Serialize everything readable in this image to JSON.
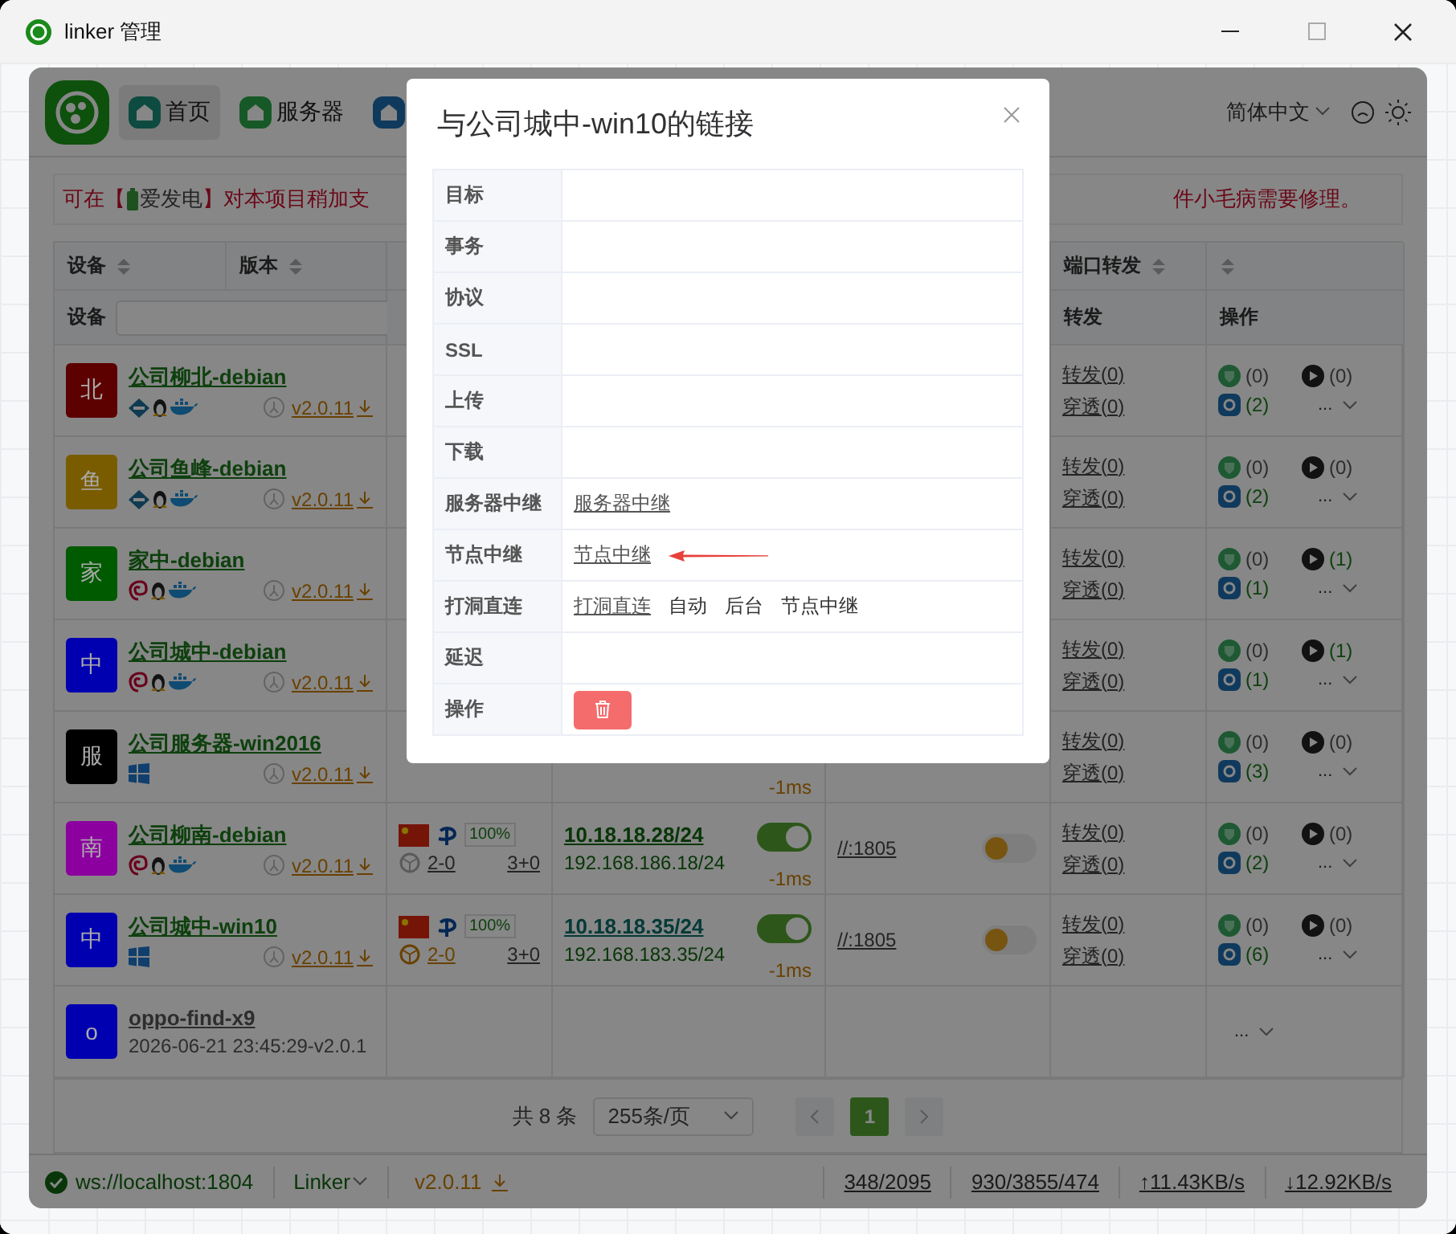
{
  "window": {
    "title": "linker 管理"
  },
  "nav": {
    "tabs": [
      {
        "label": "首页",
        "selected": true
      },
      {
        "label": "服务器",
        "selected": false
      },
      {
        "selected": false
      }
    ],
    "language": "简体中文"
  },
  "banner": {
    "before": "可在【",
    "sponsor": "爱发电",
    "after": "】对本项目稍加支",
    "tail": "件小毛病需要修理。"
  },
  "table": {
    "header_top": [
      {
        "label": "设备",
        "sort": true
      },
      {
        "label": "版本",
        "sort": true
      },
      {
        "sort": false
      },
      {
        "label": "端口转发",
        "sort": true
      },
      {
        "sort": true
      }
    ],
    "header_bottom": {
      "device": "设备",
      "forward": "转发",
      "ops": "操作"
    },
    "rows": [
      {
        "avatar": "北",
        "color": "#5c0000",
        "name": "公司柳北-debian",
        "online": true,
        "os": [
          {
            "kind": "router"
          },
          {
            "kind": "linux"
          },
          {
            "kind": "docker"
          }
        ],
        "version": "v2.0.11",
        "forward": {
          "a": "转发(0)",
          "b": "穿透(0)"
        },
        "ops": {
          "shield": "(0)",
          "shield_active": false,
          "play": "(0)",
          "play_active": false,
          "tunnel": "(2)",
          "tunnel_active": true,
          "more": "..."
        }
      },
      {
        "avatar": "鱼",
        "color": "#7a5c00",
        "name": "公司鱼峰-debian",
        "online": true,
        "os": [
          {
            "kind": "router"
          },
          {
            "kind": "linux"
          },
          {
            "kind": "docker"
          }
        ],
        "version": "v2.0.11",
        "forward": {
          "a": "转发(0)",
          "b": "穿透(0)"
        },
        "ops": {
          "shield": "(0)",
          "shield_active": false,
          "play": "(0)",
          "play_active": false,
          "tunnel": "(2)",
          "tunnel_active": true,
          "more": "..."
        }
      },
      {
        "avatar": "家",
        "color": "#005a00",
        "name": "家中-debian",
        "online": true,
        "os": [
          {
            "kind": "debian"
          },
          {
            "kind": "linux"
          },
          {
            "kind": "docker"
          }
        ],
        "version": "v2.0.11",
        "forward": {
          "a": "转发(0)",
          "b": "穿透(0)"
        },
        "ops": {
          "shield": "(0)",
          "shield_active": false,
          "play": "(1)",
          "play_active": true,
          "tunnel": "(1)",
          "tunnel_active": true,
          "more": "..."
        }
      },
      {
        "avatar": "中",
        "color": "#0000b0",
        "name": "公司城中-debian",
        "online": true,
        "os": [
          {
            "kind": "debian"
          },
          {
            "kind": "linux"
          },
          {
            "kind": "docker"
          }
        ],
        "version": "v2.0.11",
        "forward": {
          "a": "转发(0)",
          "b": "穿透(0)"
        },
        "ops": {
          "shield": "(0)",
          "shield_active": false,
          "play": "(1)",
          "play_active": true,
          "tunnel": "(1)",
          "tunnel_active": true,
          "more": "..."
        }
      },
      {
        "avatar": "服",
        "color": "#000000",
        "name": "公司服务器-win2016",
        "online": true,
        "os": [
          {
            "kind": "windows"
          }
        ],
        "version": "v2.0.11",
        "latency": "-1ms",
        "forward": {
          "a": "转发(0)",
          "b": "穿透(0)"
        },
        "ops": {
          "shield": "(0)",
          "shield_active": false,
          "play": "(0)",
          "play_active": false,
          "tunnel": "(3)",
          "tunnel_active": true,
          "more": "..."
        }
      },
      {
        "avatar": "南",
        "color": "#8c00a0",
        "name": "公司柳南-debian",
        "online": true,
        "os": [
          {
            "kind": "debian"
          },
          {
            "kind": "linux"
          },
          {
            "kind": "docker"
          }
        ],
        "version": "v2.0.11",
        "net": {
          "signal": "100%",
          "route": "2-0",
          "route_active": false,
          "count": "3+0",
          "ip": "10.18.18.28/24",
          "ip_alt": false,
          "lan": "192.168.186.18/24",
          "tunnel_on": true,
          "port": "//:1805",
          "port_on": false
        },
        "latency": "-1ms",
        "forward": {
          "a": "转发(0)",
          "b": "穿透(0)"
        },
        "ops": {
          "shield": "(0)",
          "shield_active": false,
          "play": "(0)",
          "play_active": false,
          "tunnel": "(2)",
          "tunnel_active": true,
          "more": "..."
        }
      },
      {
        "avatar": "中",
        "color": "#0000b0",
        "name": "公司城中-win10",
        "online": true,
        "os": [
          {
            "kind": "windows"
          }
        ],
        "version": "v2.0.11",
        "net": {
          "signal": "100%",
          "route": "2-0",
          "route_active": true,
          "count": "3+0",
          "ip": "10.18.18.35/24",
          "ip_alt": true,
          "lan": "192.168.183.35/24",
          "tunnel_on": true,
          "port": "//:1805",
          "port_on": false
        },
        "latency": "-1ms",
        "forward": {
          "a": "转发(0)",
          "b": "穿透(0)"
        },
        "ops": {
          "shield": "(0)",
          "shield_active": false,
          "play": "(0)",
          "play_active": false,
          "tunnel": "(6)",
          "tunnel_active": true,
          "more": "..."
        }
      },
      {
        "avatar": "o",
        "color": "#0000b0",
        "name": "oppo-find-x9",
        "online": false,
        "subtitle": "2026-06-21 23:45:29-v2.0.1",
        "ops": {
          "more": "..."
        }
      }
    ]
  },
  "pagination": {
    "total": "共 8 条",
    "page_size": "255条/页",
    "pages": [
      {
        "label": "1",
        "selected": true
      }
    ]
  },
  "status_bar": {
    "server": "ws://localhost:1804",
    "connected": true,
    "app": "Linker",
    "version": "v2.0.11",
    "stats": [
      "348/2095",
      "930/3855/474",
      "↑11.43KB/s",
      "↓12.92KB/s"
    ]
  },
  "dialog": {
    "title": "与公司城中-win10的链接",
    "rows": [
      {
        "label": "目标"
      },
      {
        "label": "事务"
      },
      {
        "label": "协议"
      },
      {
        "label": "SSL"
      },
      {
        "label": "上传"
      },
      {
        "label": "下载"
      },
      {
        "label": "服务器中继",
        "kind": "links",
        "items": [
          {
            "text": "服务器中继",
            "link": true
          }
        ]
      },
      {
        "label": "节点中继",
        "kind": "links",
        "items": [
          {
            "text": "节点中继",
            "link": true
          }
        ],
        "pointer": true
      },
      {
        "label": "打洞直连",
        "kind": "links",
        "items": [
          {
            "text": "打洞直连",
            "link": true
          },
          {
            "text": "自动",
            "link": false
          },
          {
            "text": "后台",
            "link": false
          },
          {
            "text": "节点中继",
            "link": false
          }
        ]
      },
      {
        "label": "延迟"
      },
      {
        "label": "操作",
        "kind": "delete"
      }
    ]
  }
}
